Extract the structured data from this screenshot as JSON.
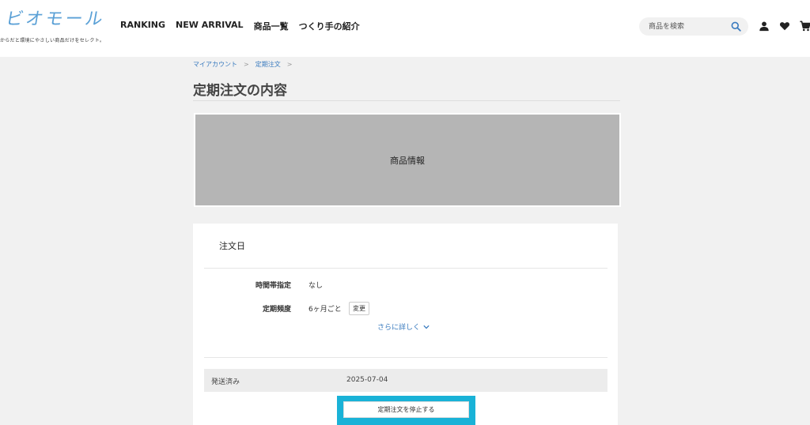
{
  "brand": {
    "logo_text": "ビオモール",
    "tagline": "からだと環境にやさしい商品だけをセレクト。"
  },
  "nav": {
    "items": [
      {
        "label": "RANKING"
      },
      {
        "label": "NEW ARRIVAL"
      },
      {
        "label": "商品一覧"
      },
      {
        "label": "つくり手の紹介"
      }
    ]
  },
  "search": {
    "placeholder": "商品を検索",
    "icon": "search-icon"
  },
  "header_icons": [
    "user-icon",
    "heart-icon",
    "cart-icon"
  ],
  "breadcrumb": {
    "items": [
      "マイアカウント",
      "定期注文"
    ],
    "separator": ">"
  },
  "page": {
    "title": "定期注文の内容"
  },
  "product": {
    "label": "商品情報"
  },
  "order": {
    "date_label": "注文日",
    "rows": [
      {
        "label": "時間帯指定",
        "value": "なし"
      },
      {
        "label": "定期頻度",
        "value": "6ヶ月ごと"
      }
    ],
    "change_label": "変更",
    "more_label": "さらに詳しく",
    "status": {
      "label": "発送済み",
      "date": "2025-07-04"
    },
    "stop_label": "定期注文を停止する"
  },
  "colors": {
    "accent": "#3a7bbf",
    "highlight": "#19b2d7",
    "logo": "#5aa0d6",
    "product_bg": "#b5b5b5"
  }
}
